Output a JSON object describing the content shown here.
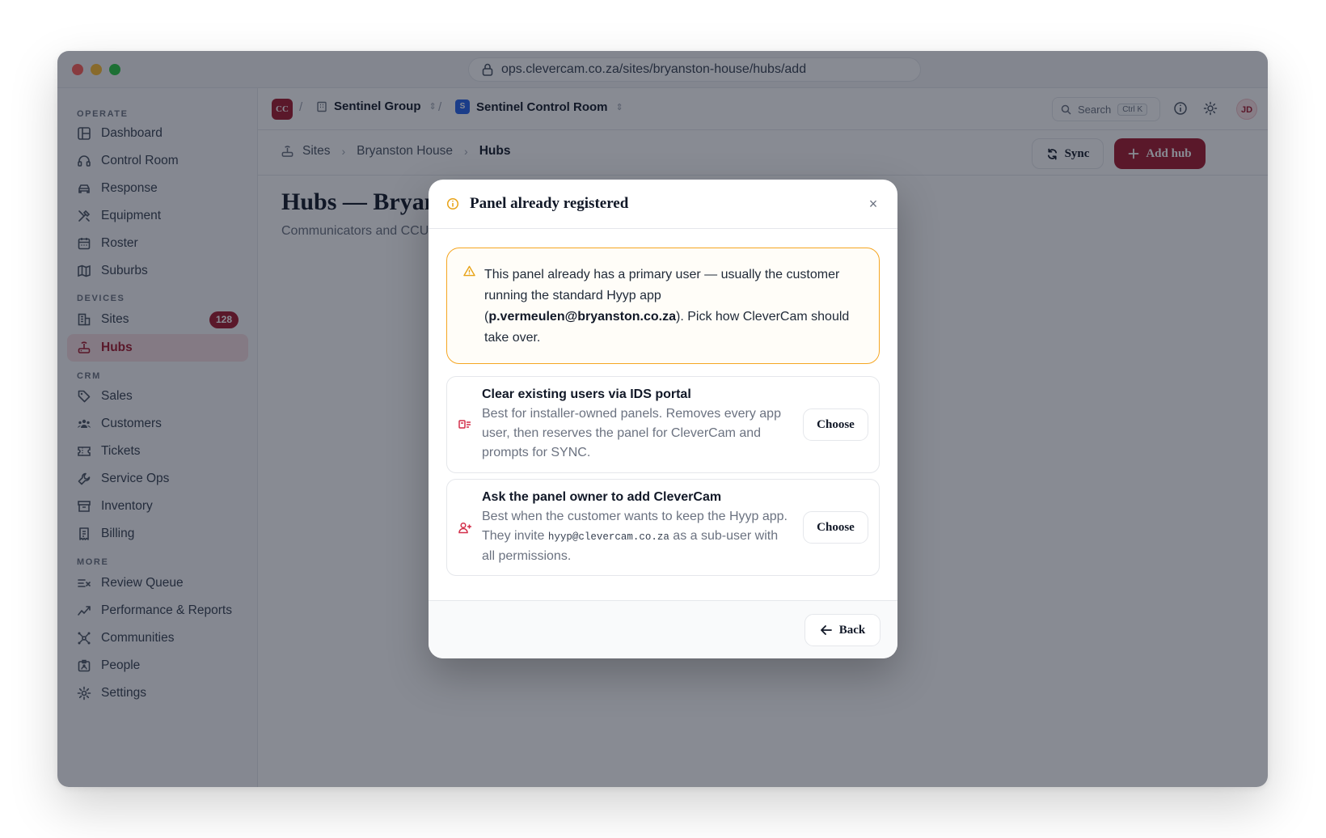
{
  "browser": {
    "url": "ops.clevercam.co.za/sites/bryanston-house/hubs/add"
  },
  "sidebar": {
    "sections": [
      {
        "label": "OPERATE"
      },
      {
        "label": "DEVICES"
      },
      {
        "label": "CRM"
      },
      {
        "label": "MORE"
      }
    ],
    "items": [
      {
        "label": "Dashboard",
        "icon": "layout-dashboard-icon"
      },
      {
        "label": "Control Room",
        "icon": "headset-icon"
      },
      {
        "label": "Response",
        "icon": "car-icon"
      },
      {
        "label": "Equipment",
        "icon": "tools-icon"
      },
      {
        "label": "Roster",
        "icon": "calendar-icon"
      },
      {
        "label": "Suburbs",
        "icon": "map-icon"
      },
      {
        "label": "Sites",
        "icon": "building-icon",
        "badge": "128"
      },
      {
        "label": "Hubs",
        "icon": "router-icon",
        "active": true
      },
      {
        "label": "Sales",
        "icon": "tag-icon"
      },
      {
        "label": "Customers",
        "icon": "users-icon"
      },
      {
        "label": "Tickets",
        "icon": "ticket-icon"
      },
      {
        "label": "Service Ops",
        "icon": "wrench-icon"
      },
      {
        "label": "Inventory",
        "icon": "archive-icon"
      },
      {
        "label": "Billing",
        "icon": "receipt-icon"
      },
      {
        "label": "Review Queue",
        "icon": "list-check-icon"
      },
      {
        "label": "Performance & Reports",
        "icon": "trending-icon"
      },
      {
        "label": "Communities",
        "icon": "network-icon"
      },
      {
        "label": "People",
        "icon": "id-badge-icon"
      },
      {
        "label": "Settings",
        "icon": "gear-icon"
      }
    ]
  },
  "topbar": {
    "org_logo": "CC",
    "org": "Sentinel Group",
    "room_badge": "S",
    "room": "Sentinel Control Room",
    "search_label": "Search",
    "search_shortcut": "Ctrl K",
    "avatar": "JD"
  },
  "pagebar": {
    "breadcrumbs": [
      "Sites",
      "Bryanston House",
      "Hubs"
    ],
    "sync_label": "Sync",
    "add_label": "Add hub"
  },
  "content": {
    "title": "Hubs — Bryanston House",
    "subtitle": "Communicators and CCUs"
  },
  "modal": {
    "title": "Panel already registered",
    "warning": {
      "text_before": "This panel already has a primary user — usually the customer running the standard Hyyp app (",
      "email": "p.vermeulen@bryanston.co.za",
      "text_after": "). Pick how CleverCam should take over."
    },
    "options": [
      {
        "title": "Clear existing users via IDS portal",
        "description": "Best for installer-owned panels. Removes every app user, then reserves the panel for CleverCam and prompts for SYNC.",
        "button": "Choose"
      },
      {
        "title": "Ask the panel owner to add CleverCam",
        "desc_before": "Best when the customer wants to keep the Hyyp app. They invite ",
        "desc_code": "hyyp@clevercam.co.za",
        "desc_after": " as a sub-user with all permissions.",
        "button": "Choose"
      }
    ],
    "back_label": "Back"
  },
  "colors": {
    "brand": "#a3182c",
    "warning": "#f5a623"
  }
}
